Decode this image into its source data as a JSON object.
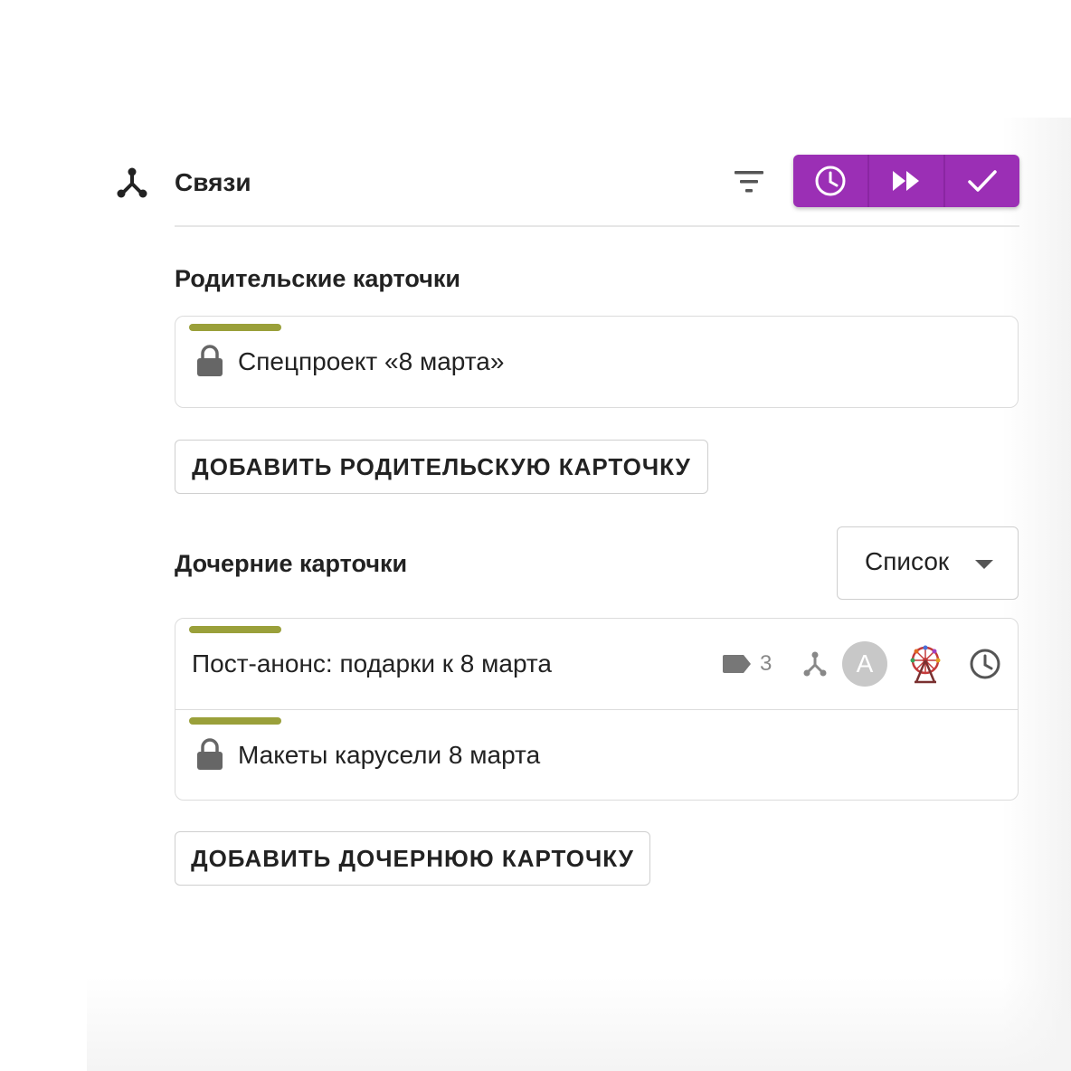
{
  "header": {
    "title": "Связи",
    "accent_color": "#9b2fb5",
    "actions": [
      "clock-icon",
      "fast-forward-icon",
      "check-icon"
    ]
  },
  "parents": {
    "title": "Родительские карточки",
    "cards": [
      {
        "title": "Спецпроект «8 марта»",
        "locked": true,
        "stripe_color": "#9aa03a"
      }
    ],
    "add_label": "ДОБАВИТЬ РОДИТЕЛЬСКУЮ КАРТОЧКУ"
  },
  "children": {
    "title": "Дочерние карточки",
    "view_select": {
      "value": "Список"
    },
    "cards": [
      {
        "title": "Пост-анонс: подарки к 8 марта",
        "locked": false,
        "stripe_color": "#9aa03a",
        "tag_count": "3",
        "avatar_letter": "A"
      },
      {
        "title": "Макеты карусели 8 марта",
        "locked": true,
        "stripe_color": "#9aa03a"
      }
    ],
    "add_label": "ДОБАВИТЬ ДОЧЕРНЮЮ КАРТОЧКУ"
  }
}
